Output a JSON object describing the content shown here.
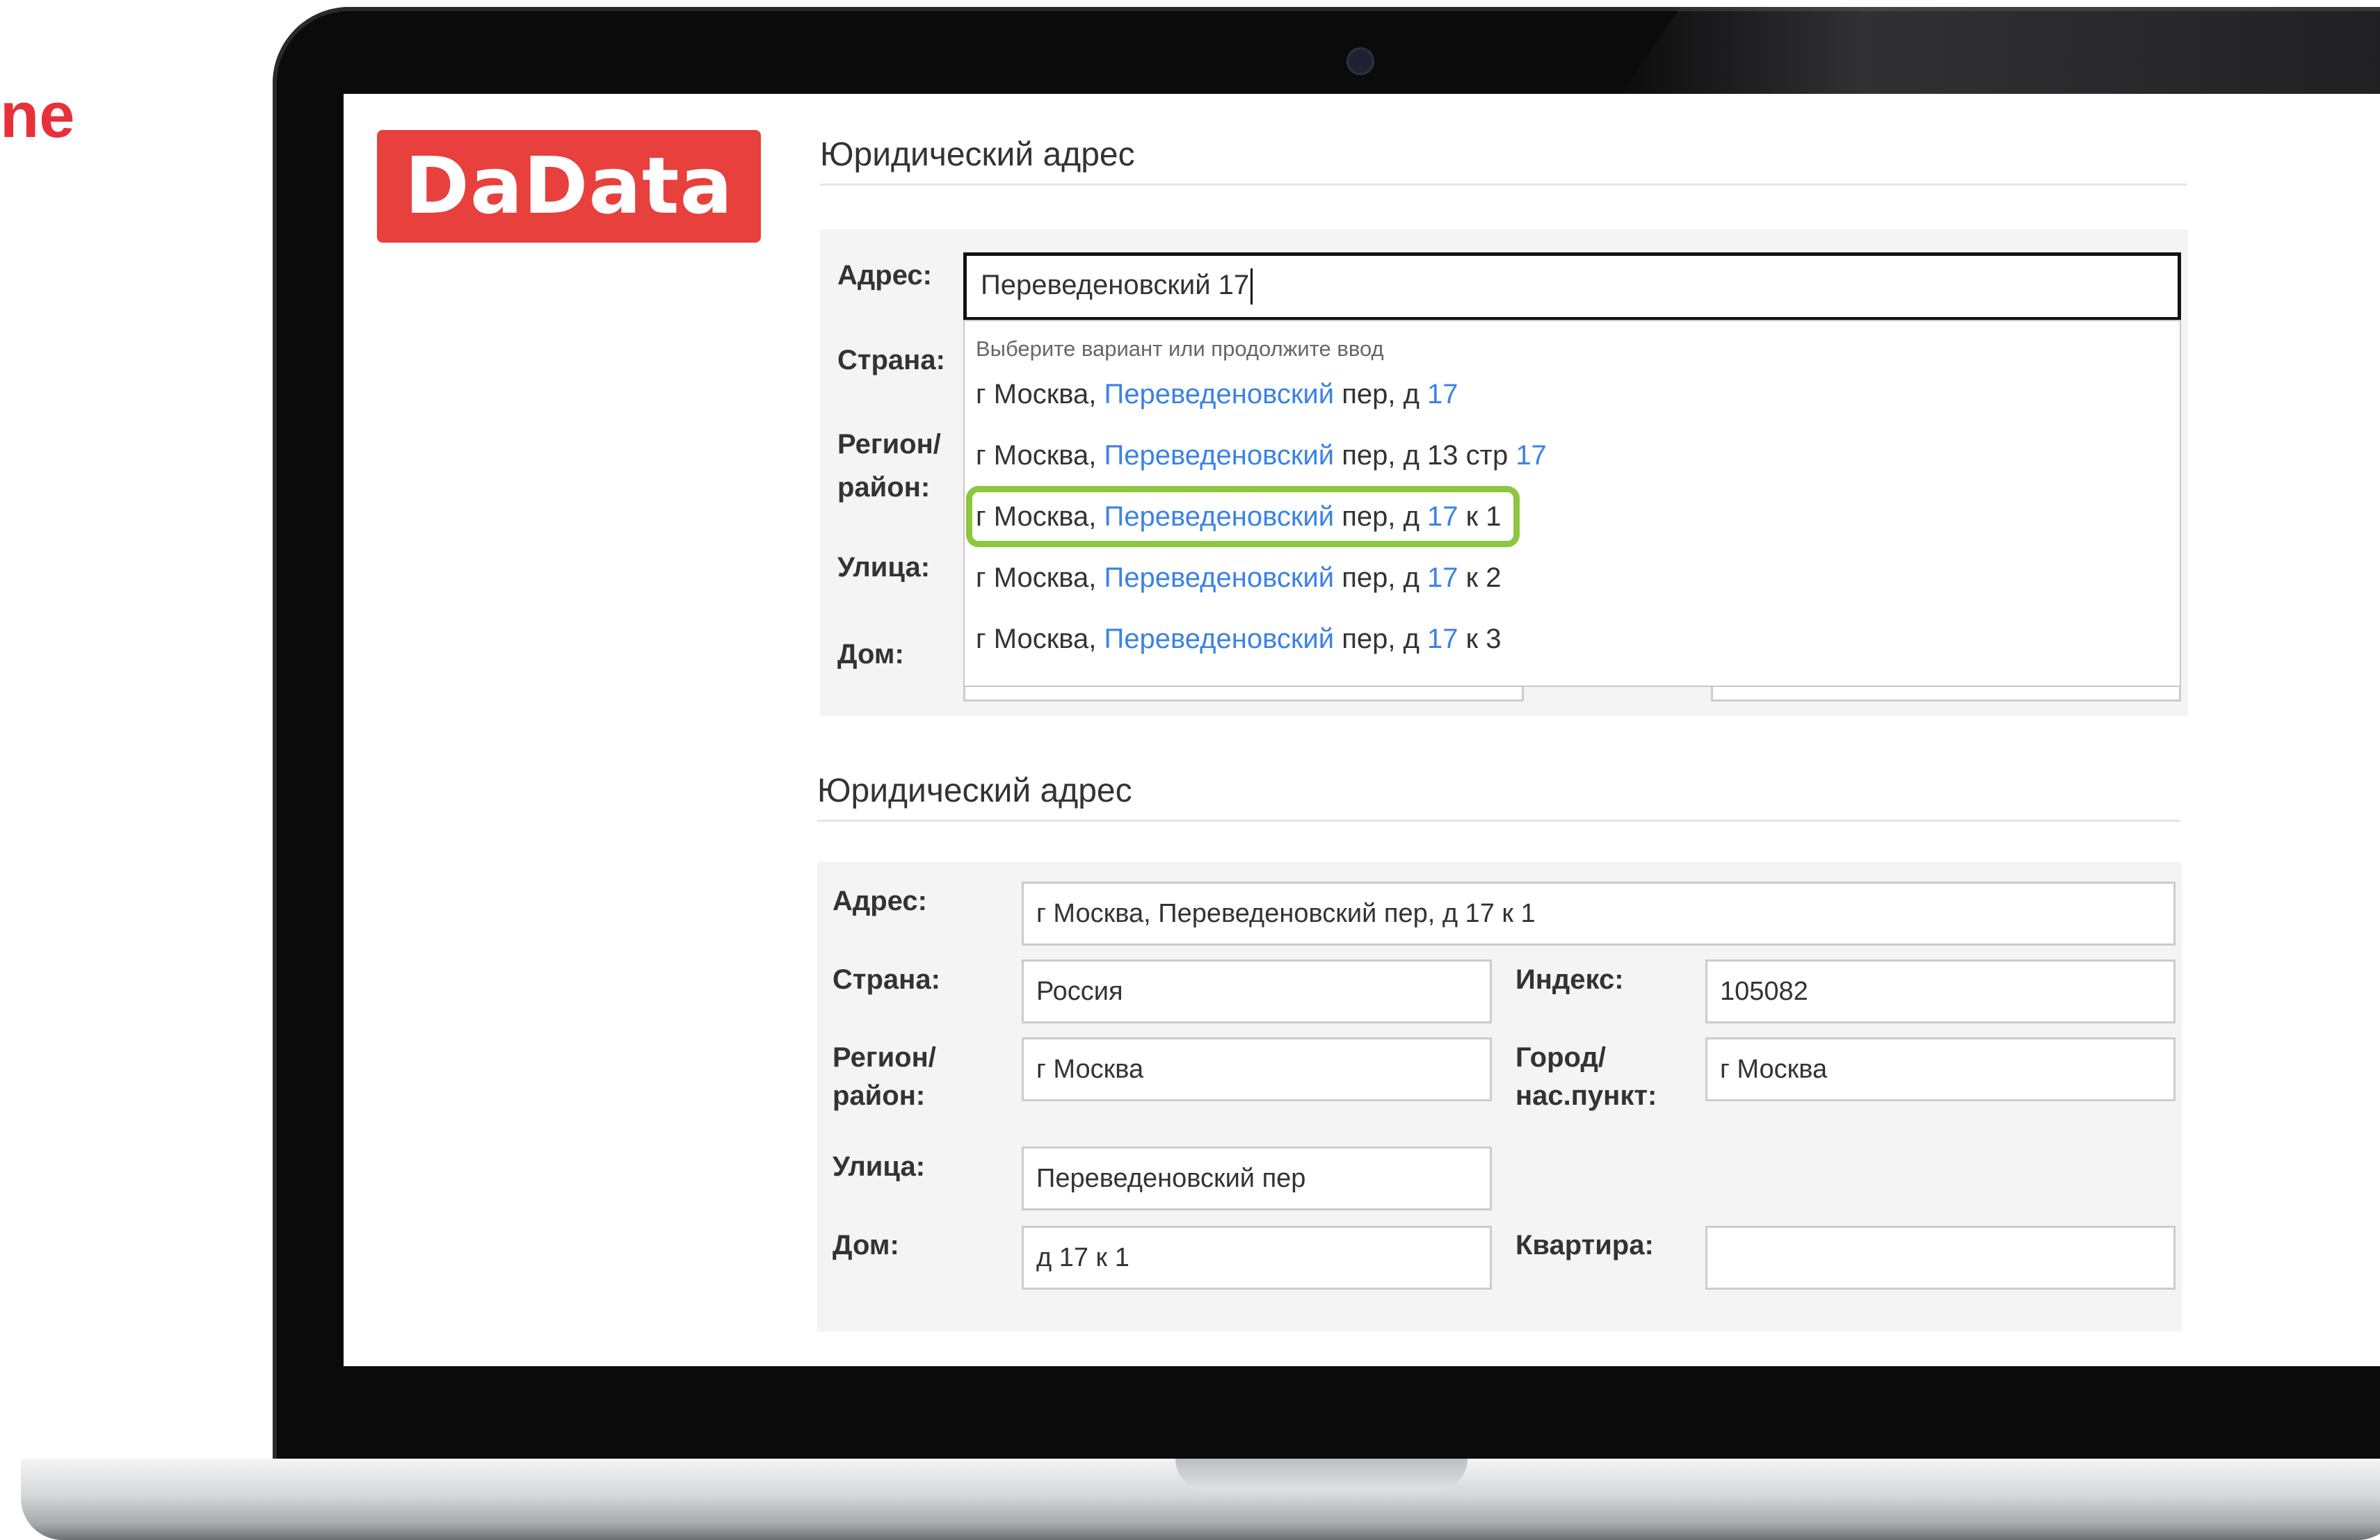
{
  "side_text": "ne",
  "logo": "DaData",
  "top_form": {
    "title": "Юридический адрес",
    "address_label": "Адрес:",
    "address_value": "Переведеновский 17",
    "country_label": "Страна:",
    "region_label_1": "Регион/",
    "region_label_2": "район:",
    "street_label": "Улица:",
    "house_label": "Дом:",
    "dropdown": {
      "hint": "Выберите вариант или продолжите ввод",
      "items": [
        {
          "p1": "г Москва, ",
          "h1": "Переведеновский",
          "p2": " пер, д ",
          "h2": "17",
          "p3": ""
        },
        {
          "p1": "г Москва, ",
          "h1": "Переведеновский",
          "p2": " пер, д 13 стр ",
          "h2": "17",
          "p3": ""
        },
        {
          "p1": "г Москва, ",
          "h1": "Переведеновский",
          "p2": " пер, д ",
          "h2": "17",
          "p3": " к 1"
        },
        {
          "p1": "г Москва, ",
          "h1": "Переведеновский",
          "p2": " пер, д ",
          "h2": "17",
          "p3": " к 2"
        },
        {
          "p1": "г Москва, ",
          "h1": "Переведеновский",
          "p2": " пер, д ",
          "h2": "17",
          "p3": " к 3"
        }
      ],
      "selected_index": 2
    }
  },
  "bottom_form": {
    "title": "Юридический адрес",
    "address_label": "Адрес:",
    "address_value": "г Москва, Переведеновский пер, д 17 к 1",
    "country_label": "Страна:",
    "country_value": "Россия",
    "index_label": "Индекс:",
    "index_value": "105082",
    "region_label_1": "Регион/",
    "region_label_2": "район:",
    "region_value": "г Москва",
    "city_label_1": "Город/",
    "city_label_2": "нас.пункт:",
    "city_value": "г Москва",
    "street_label": "Улица:",
    "street_value": "Переведеновский пер",
    "house_label": "Дом:",
    "house_value": "д 17 к 1",
    "flat_label": "Квартира:",
    "flat_value": ""
  },
  "colors": {
    "brand": "#e8403d",
    "highlight": "#3b82e6",
    "selection_outline": "#8dc63f"
  }
}
